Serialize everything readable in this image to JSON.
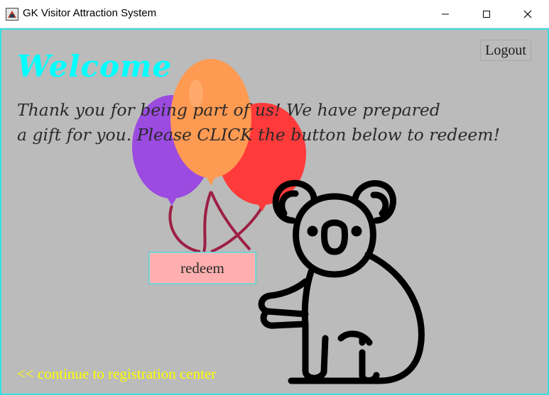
{
  "window": {
    "title": "GK Visitor Attraction System",
    "controls": [
      "minimize",
      "maximize",
      "close"
    ]
  },
  "header": {
    "welcome": "Welcome",
    "logout_label": "Logout"
  },
  "main": {
    "message_line1": "Thank you for being part of us! We have prepared",
    "message_line2": "a gift for you. Please CLICK the button below to redeem!",
    "redeem_label": "redeem",
    "continue_link": "<< continue to registration center"
  },
  "illustrations": [
    "balloons-illustration",
    "koala-illustration"
  ],
  "colors": {
    "background": "#bbbbbb",
    "border": "#34e0e0",
    "welcome": "#00ffff",
    "redeem_bg": "#ffafaf",
    "link": "#ffff00",
    "balloon_purple": "#9b4be0",
    "balloon_orange": "#ff9a52",
    "balloon_red": "#ff3a3a",
    "string": "#9e1f45"
  }
}
